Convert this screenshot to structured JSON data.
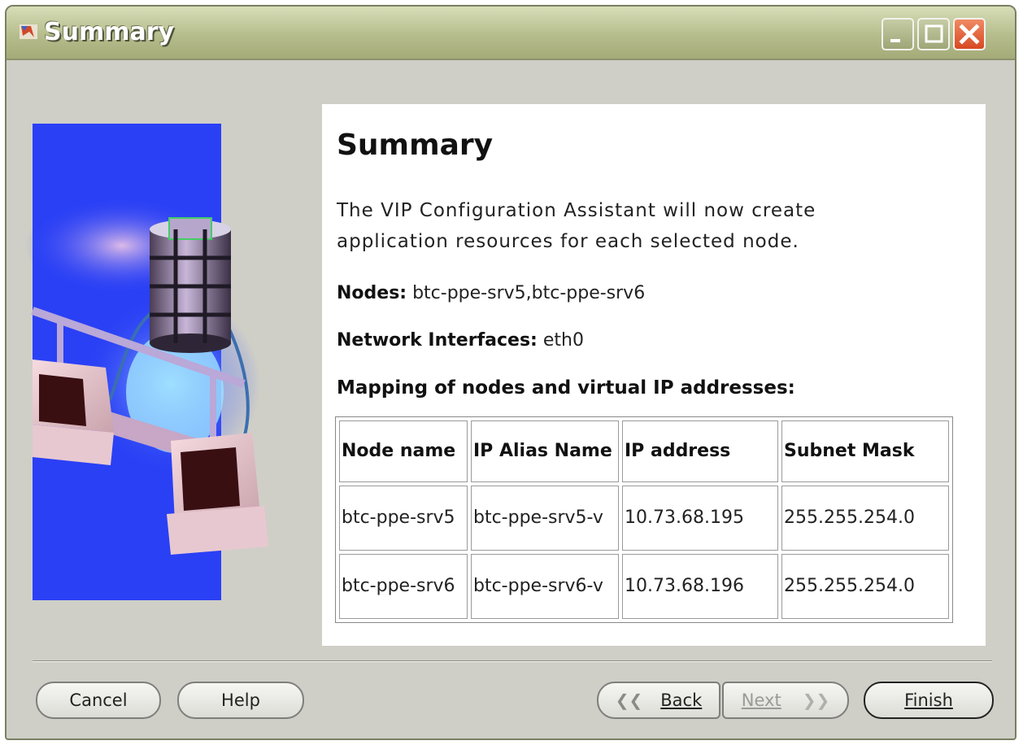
{
  "window": {
    "title": "Summary"
  },
  "content": {
    "heading": "Summary",
    "description": "The VIP Configuration Assistant will now create application resources for each selected node.",
    "nodes_label": "Nodes:",
    "nodes_value": "btc-ppe-srv5,btc-ppe-srv6",
    "interfaces_label": "Network Interfaces:",
    "interfaces_value": "eth0",
    "mapping_label": "Mapping of nodes and virtual IP addresses:",
    "table": {
      "headers": [
        "Node name",
        "IP Alias Name",
        "IP address",
        "Subnet Mask"
      ],
      "rows": [
        [
          "btc-ppe-srv5",
          "btc-ppe-srv5-v",
          "10.73.68.195",
          "255.255.254.0"
        ],
        [
          "btc-ppe-srv6",
          "btc-ppe-srv6-v",
          "10.73.68.196",
          "255.255.254.0"
        ]
      ]
    }
  },
  "buttons": {
    "cancel": "Cancel",
    "help": "Help",
    "back": "Back",
    "next": "Next",
    "finish": "Finish"
  },
  "icons": {
    "app": "oracle-installer-icon",
    "minimize": "minimize-icon",
    "maximize": "maximize-icon",
    "close": "close-icon",
    "back_arrow": "chevron-left-icon",
    "next_arrow": "chevron-right-icon"
  },
  "colors": {
    "titlebar": "#b6bd8c",
    "close_button": "#d74822",
    "banner_blue": "#2a40f5",
    "window_bg": "#cfcfc8"
  },
  "state": {
    "next_enabled": false
  }
}
